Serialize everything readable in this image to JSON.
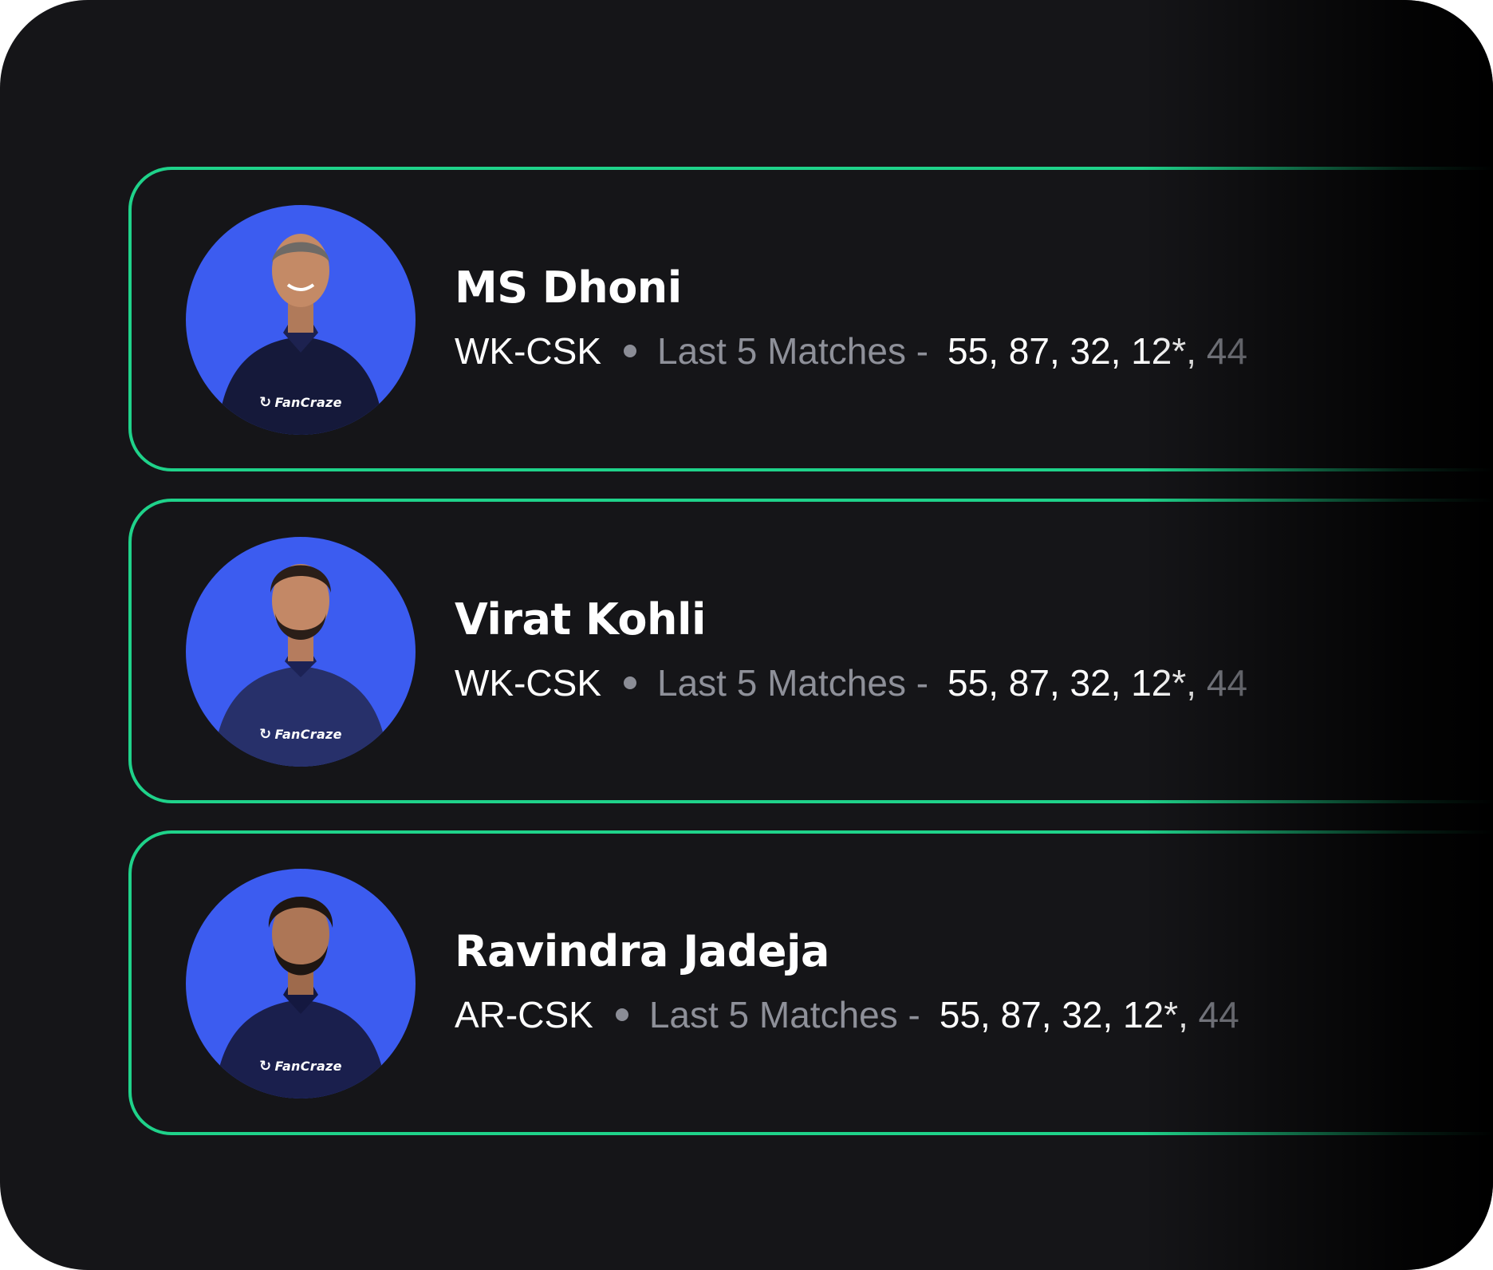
{
  "colors": {
    "panel_bg": "#151518",
    "card_border": "#1fd28a",
    "avatar_bg": "#3c5cf0",
    "text_primary": "#ffffff",
    "text_muted": "#8e9099"
  },
  "players": [
    {
      "name": "MS Dhoni",
      "role": "WK-CSK",
      "matches_label": "Last 5 Matches -",
      "scores": "55, 87, 32, 12*,",
      "last_score": "44",
      "brand": "FanCraze"
    },
    {
      "name": "Virat Kohli",
      "role": "WK-CSK",
      "matches_label": "Last 5 Matches -",
      "scores": "55, 87, 32, 12*,",
      "last_score": "44",
      "brand": "FanCraze"
    },
    {
      "name": "Ravindra Jadeja",
      "role": "AR-CSK",
      "matches_label": "Last 5 Matches -",
      "scores": "55, 87, 32, 12*,",
      "last_score": "44",
      "brand": "FanCraze"
    }
  ]
}
